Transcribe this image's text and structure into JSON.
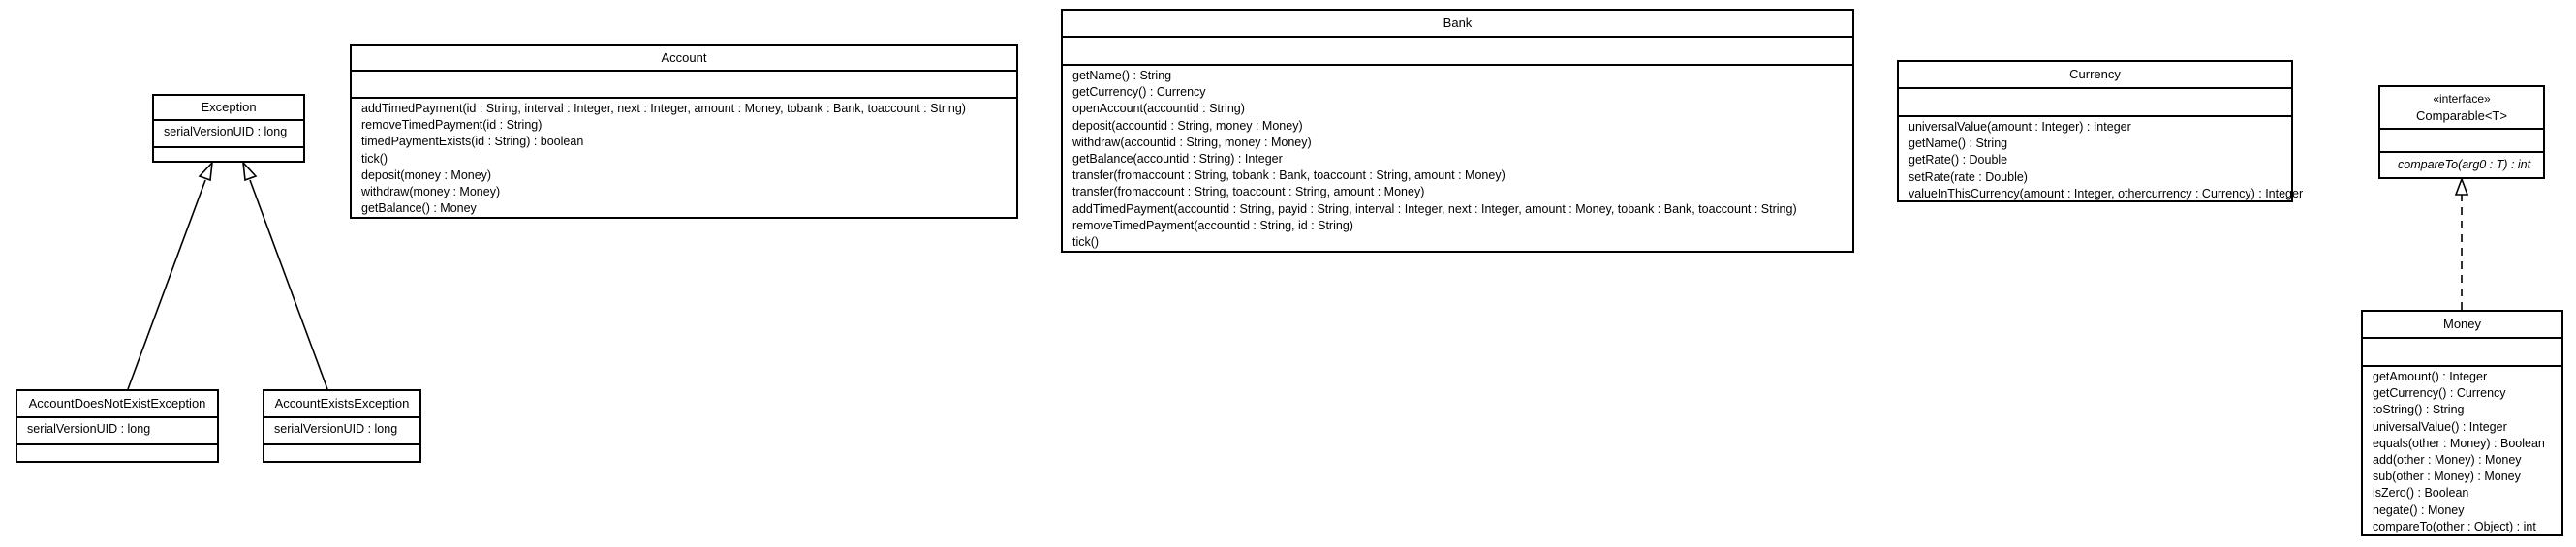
{
  "classes": {
    "exception": {
      "name": "Exception",
      "attributes": [
        "serialVersionUID : long"
      ],
      "operations": []
    },
    "account": {
      "name": "Account",
      "attributes": [],
      "operations": [
        "addTimedPayment(id : String, interval : Integer, next : Integer, amount : Money, tobank : Bank, toaccount : String)",
        "removeTimedPayment(id : String)",
        "timedPaymentExists(id : String) : boolean",
        "tick()",
        "deposit(money : Money)",
        "withdraw(money : Money)",
        "getBalance() : Money"
      ]
    },
    "bank": {
      "name": "Bank",
      "attributes": [],
      "operations": [
        "getName() : String",
        "getCurrency() : Currency",
        "openAccount(accountid : String)",
        "deposit(accountid : String, money : Money)",
        "withdraw(accountid : String, money : Money)",
        "getBalance(accountid : String) : Integer",
        "transfer(fromaccount : String, tobank : Bank, toaccount : String, amount : Money)",
        "transfer(fromaccount : String, toaccount : String, amount : Money)",
        "addTimedPayment(accountid : String, payid : String, interval : Integer, next : Integer, amount : Money, tobank : Bank, toaccount : String)",
        "removeTimedPayment(accountid : String, id : String)",
        "tick()"
      ]
    },
    "currency": {
      "name": "Currency",
      "attributes": [],
      "operations": [
        "universalValue(amount : Integer) : Integer",
        "getName() : String",
        "getRate() : Double",
        "setRate(rate : Double)",
        "valueInThisCurrency(amount : Integer, othercurrency : Currency) : Integer"
      ]
    },
    "comparable": {
      "stereotype": "«interface»",
      "name": "Comparable<T>",
      "attributes": [],
      "operations": [
        "compareTo(arg0 : T) : int"
      ]
    },
    "money": {
      "name": "Money",
      "attributes": [],
      "operations": [
        "getAmount() : Integer",
        "getCurrency() : Currency",
        "toString() : String",
        "universalValue() : Integer",
        "equals(other : Money) : Boolean",
        "add(other : Money) : Money",
        "sub(other : Money) : Money",
        "isZero() : Boolean",
        "negate() : Money",
        "compareTo(other : Object) : int"
      ]
    },
    "accountDoesNotExist": {
      "name": "AccountDoesNotExistException",
      "attributes": [
        "serialVersionUID : long"
      ],
      "operations": []
    },
    "accountExists": {
      "name": "AccountExistsException",
      "attributes": [
        "serialVersionUID : long"
      ],
      "operations": []
    }
  },
  "relations": [
    {
      "type": "generalization",
      "from": "AccountDoesNotExistException",
      "to": "Exception"
    },
    {
      "type": "generalization",
      "from": "AccountExistsException",
      "to": "Exception"
    },
    {
      "type": "realization",
      "from": "Money",
      "to": "Comparable<T>"
    }
  ]
}
